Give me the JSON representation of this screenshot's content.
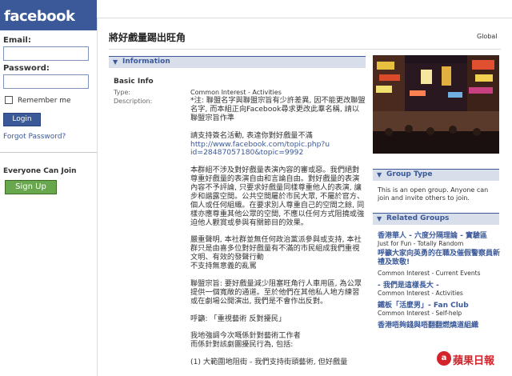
{
  "sidebar": {
    "logo": "facebook",
    "email_label": "Email:",
    "password_label": "Password:",
    "remember_label": "Remember me",
    "login_label": "Login",
    "forgot_label": "Forgot Password?",
    "join_text": "Everyone Can Join",
    "signup_label": "Sign Up"
  },
  "header": {
    "group_title": "將好戲量踢出旺角",
    "global_label": "Global"
  },
  "information": {
    "section_label": "Information",
    "heading": "Basic Info",
    "type_key": "Type:",
    "type_value": "Common Interest - Activities",
    "description_key": "Description:",
    "description": [
      "*注: 聯盟名字與聯盟宗旨有少許差異, 因不能更改聯盟名字, 而本組正向Facebook尋求更改此羣名稱, 請以聯盟宗旨作準",
      "請支持簽名活動, 表達你對好戲量不滿",
      "本群組不涉及對好戲量表演內容的審或惡。我們絕對尊重好戲量的表演自由和言論自由。對好戲量的表演內容不予評論, 只要求好戲量同樣尊重他人的表演, 讓步和諧露空間。公共空間屬於市民大眾, 不屬於官方、個人或任何組織。在要求別人尊重自己的空間之餘, 同樣亦應尊重其他公眾的空間, 不應以任何方式阻撓或強迫他人觀賞或參與有關節目的效果。",
      "嚴重聲明, 本社群並無任何政治黨派參與或支持, 本社群只是由喜多位對好戲量有不滿的市民組成我們重視文明、有效的發聲行動\n不支持無意義的亂罵",
      "聯盟宗旨: 要好戲量減少阻塞旺角行人車用區, 為公眾提供一個寬敞的通道。至於他們在其他私人地方練習或在劇場公開演出, 我們是不會作出反對。",
      "呼籲: 「重視藝術  反對擾民」",
      "我地強調今次嘅係針對藝術工作者\n而係針對該劇團擾民行為, 包括:",
      "(1) 大範圍地阻街 - 我們支持街頭藝術, 但好戲量"
    ],
    "url_line": "http://www.facebook.com/topic.php?u\nid=28487057180&topic=9992"
  },
  "group_type": {
    "section_label": "Group Type",
    "text": "This is an open group. Anyone can join and invite others to join."
  },
  "related_groups": {
    "section_label": "Related Groups",
    "items": [
      {
        "name": "香港華人 - 六度分隔理論 - 實驗區",
        "category": "Just for Fun - Totally Random"
      },
      {
        "name": "呼籲大家向英勇的在職及催假警察員新禮及致敬!",
        "category": "Common Interest - Current Events"
      },
      {
        "name": "- 我們是這樣長大 -",
        "category": "Common Interest - Activities"
      },
      {
        "name": "鐵板「活麼男」- Fan Club",
        "category": "Common Interest - Self-help"
      },
      {
        "name": "香港唔夠錢與唔翻翻燃燒道組織",
        "category": ""
      }
    ]
  },
  "watermark": {
    "badge": "a",
    "text": "蘋果日報"
  }
}
